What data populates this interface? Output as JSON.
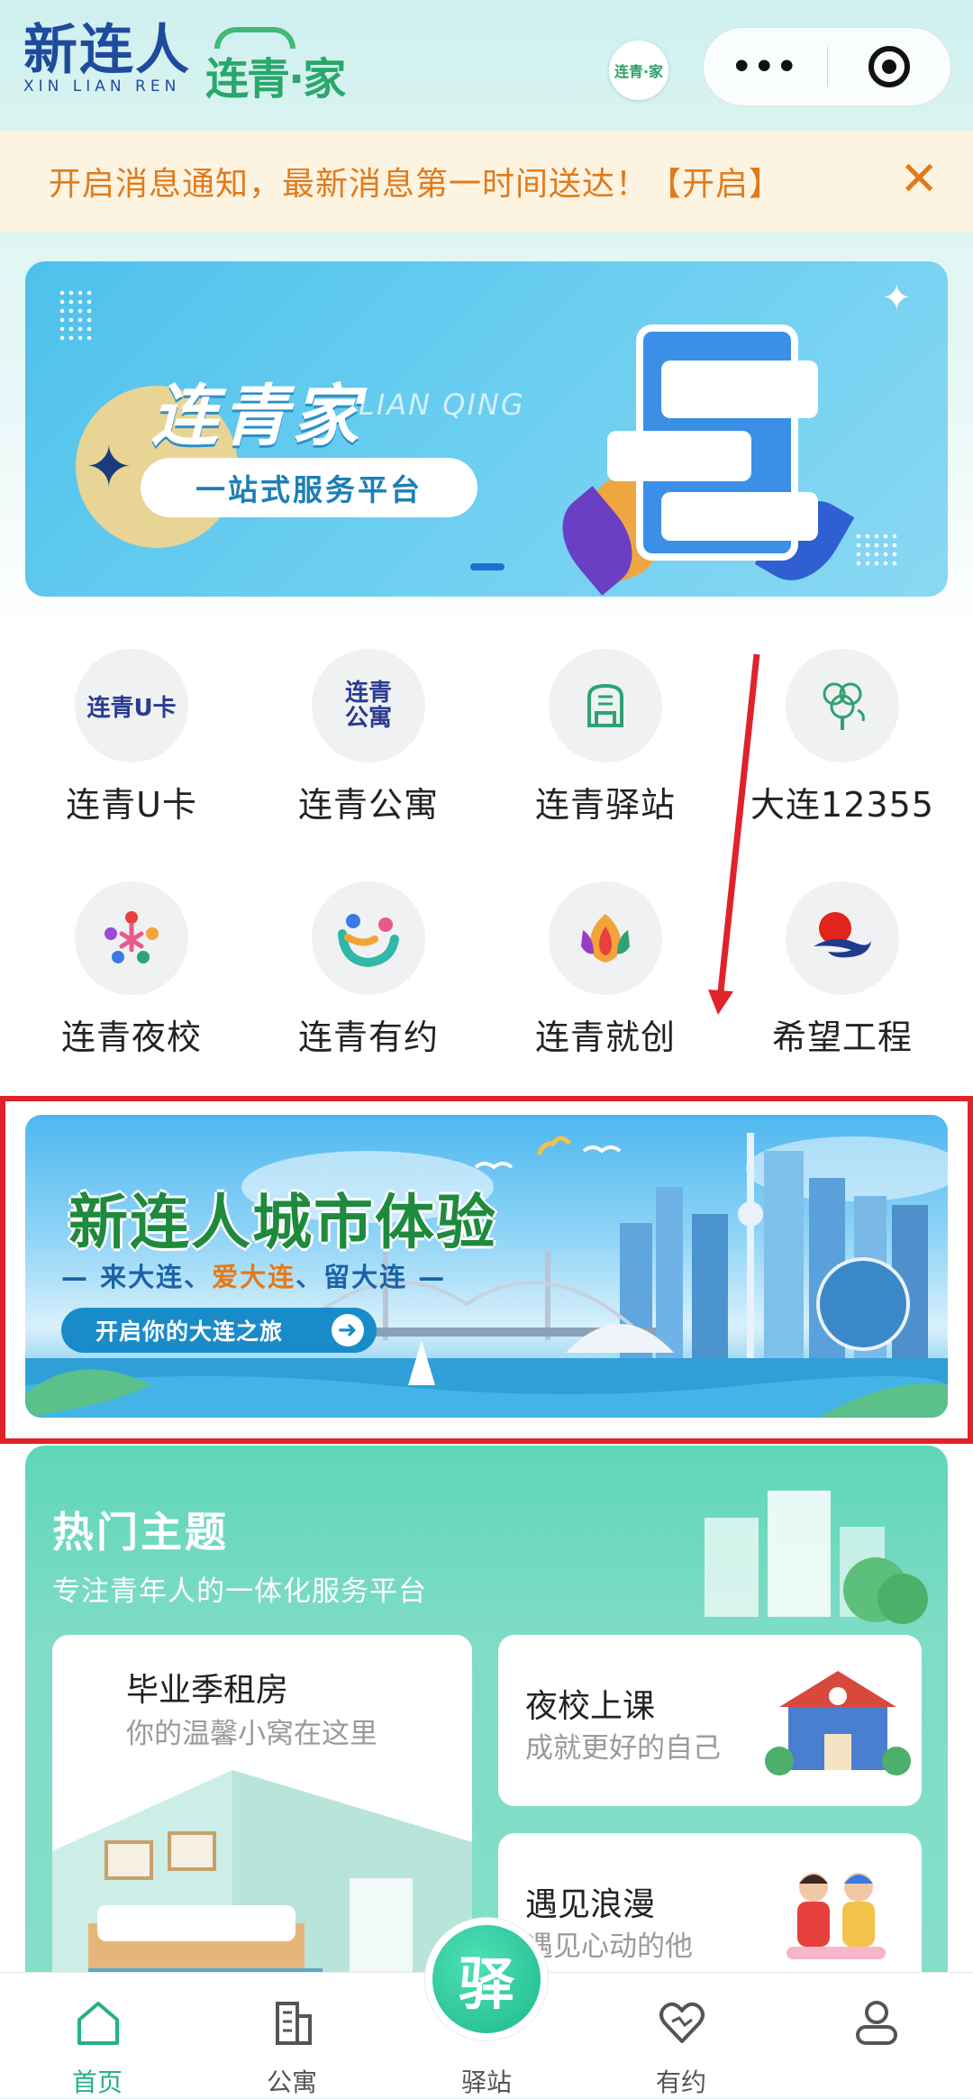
{
  "header": {
    "logo_main": "新连人",
    "logo_main_en": "XIN LIAN REN",
    "logo_sub": "连青·家",
    "badge": "连青·家",
    "more_icon": "more-dots-icon",
    "close_icon": "target-icon"
  },
  "notice": {
    "text": "开启消息通知，最新消息第一时间送达！【开启】",
    "close": "✕"
  },
  "banner1": {
    "title": "连青家",
    "title_en": "LIAN QING",
    "subtitle": "一站式服务平台"
  },
  "grid": [
    {
      "label": "连青U卡",
      "icon": "u-card-icon",
      "logo_text": "连青U卡"
    },
    {
      "label": "连青公寓",
      "icon": "apartment-icon",
      "logo_text": "连青公寓"
    },
    {
      "label": "连青驿站",
      "icon": "station-icon"
    },
    {
      "label": "大连12355",
      "icon": "tree-icon"
    },
    {
      "label": "连青夜校",
      "icon": "night-school-icon"
    },
    {
      "label": "连青有约",
      "icon": "dating-icon"
    },
    {
      "label": "连青就创",
      "icon": "entrepreneurship-icon"
    },
    {
      "label": "希望工程",
      "icon": "hope-project-icon"
    }
  ],
  "banner2": {
    "title": "新连人城市体验",
    "slogan_1": "来大连、",
    "slogan_2": "爱大连",
    "slogan_3": "、留大连",
    "button": "开启你的大连之旅"
  },
  "hot": {
    "title": "热门主题",
    "subtitle": "专注青年人的一体化服务平台",
    "cards": [
      {
        "title": "毕业季租房",
        "sub": "你的温馨小窝在这里"
      },
      {
        "title": "夜校上课",
        "sub": "成就更好的自己"
      },
      {
        "title": "遇见浪漫",
        "sub": "遇见心动的他"
      }
    ]
  },
  "tabbar": {
    "tabs": [
      {
        "label": "首页",
        "icon": "home-icon"
      },
      {
        "label": "公寓",
        "icon": "building-icon"
      },
      {
        "label": "驿站",
        "icon": "station-icon"
      },
      {
        "label": "有约",
        "icon": "heart-icon"
      },
      {
        "label": "",
        "icon": "user-icon"
      }
    ],
    "center": "驿"
  },
  "colors": {
    "accent": "#24b089",
    "notice_text": "#e07b1b",
    "highlight_frame": "#e0232a"
  }
}
